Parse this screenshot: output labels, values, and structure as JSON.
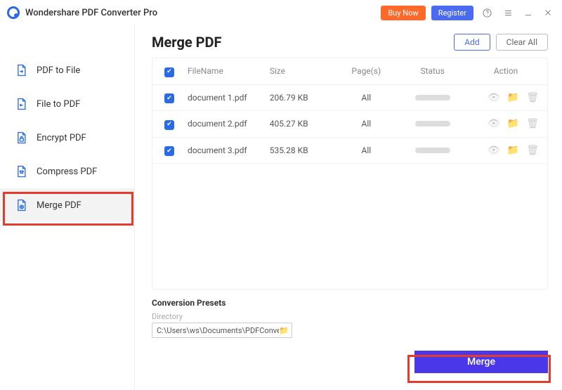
{
  "app": {
    "title": "Wondershare PDF Converter Pro"
  },
  "title_actions": {
    "buy_now": "Buy Now",
    "register": "Register"
  },
  "sidebar": {
    "items": [
      {
        "label": "PDF to File"
      },
      {
        "label": "File to PDF"
      },
      {
        "label": "Encrypt PDF"
      },
      {
        "label": "Compress PDF"
      },
      {
        "label": "Merge PDF"
      }
    ]
  },
  "page": {
    "title": "Merge PDF"
  },
  "header_actions": {
    "add": "Add",
    "clear_all": "Clear All"
  },
  "table": {
    "columns": {
      "filename": "FileName",
      "size": "Size",
      "pages": "Page(s)",
      "status": "Status",
      "action": "Action"
    },
    "rows": [
      {
        "filename": "document 1.pdf",
        "size": "206.79 KB",
        "pages": "All"
      },
      {
        "filename": "document 2.pdf",
        "size": "405.27 KB",
        "pages": "All"
      },
      {
        "filename": "document 3.pdf",
        "size": "535.28 KB",
        "pages": "All"
      }
    ]
  },
  "presets": {
    "title": "Conversion Presets",
    "directory_label": "Directory",
    "directory_value": "C:\\Users\\ws\\Documents\\PDFConvert"
  },
  "merge_button": "Merge"
}
